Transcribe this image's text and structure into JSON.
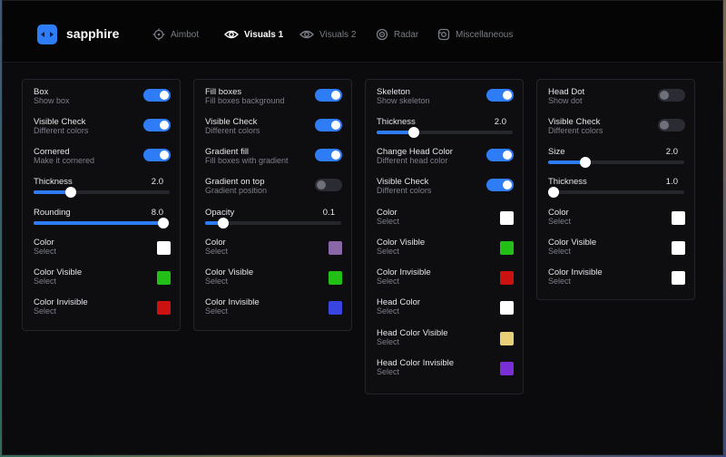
{
  "brand": {
    "name": "sapphire",
    "accent": "#2f7df6"
  },
  "tabs": [
    {
      "label": "Aimbot",
      "icon": "crosshair-icon",
      "active": false
    },
    {
      "label": "Visuals 1",
      "icon": "eye-icon",
      "active": true
    },
    {
      "label": "Visuals 2",
      "icon": "eye-icon",
      "active": false
    },
    {
      "label": "Radar",
      "icon": "radar-icon",
      "active": false
    },
    {
      "label": "Miscellaneous",
      "icon": "misc-icon",
      "active": false
    }
  ],
  "panels": [
    {
      "rows": [
        {
          "type": "toggle",
          "label": "Box",
          "sub": "Show box",
          "on": true
        },
        {
          "type": "toggle",
          "label": "Visible Check",
          "sub": "Different colors",
          "on": true
        },
        {
          "type": "toggle",
          "label": "Cornered",
          "sub": "Make it cornered",
          "on": true
        },
        {
          "type": "slider",
          "label": "Thickness",
          "value": "2.0",
          "fraction": 0.27
        },
        {
          "type": "slider",
          "label": "Rounding",
          "value": "8.0",
          "fraction": 0.95
        },
        {
          "type": "color",
          "label": "Color",
          "sub": "Select",
          "color": "#ffffff"
        },
        {
          "type": "color",
          "label": "Color Visible",
          "sub": "Select",
          "color": "#22c016"
        },
        {
          "type": "color",
          "label": "Color Invisible",
          "sub": "Select",
          "color": "#cc1111"
        }
      ]
    },
    {
      "rows": [
        {
          "type": "toggle",
          "label": "Fill boxes",
          "sub": "Fill boxes background",
          "on": true
        },
        {
          "type": "toggle",
          "label": "Visible Check",
          "sub": "Different colors",
          "on": true
        },
        {
          "type": "toggle",
          "label": "Gradient fill",
          "sub": "Fill boxes with gradient",
          "on": true
        },
        {
          "type": "toggle",
          "label": "Gradient on top",
          "sub": "Gradient position",
          "on": false
        },
        {
          "type": "slider",
          "label": "Opacity",
          "value": "0.1",
          "fraction": 0.13
        },
        {
          "type": "color",
          "label": "Color",
          "sub": "Select",
          "color": "#8a68a8"
        },
        {
          "type": "color",
          "label": "Color Visible",
          "sub": "Select",
          "color": "#22c016"
        },
        {
          "type": "color",
          "label": "Color Invisible",
          "sub": "Select",
          "color": "#3a44e0"
        }
      ]
    },
    {
      "rows": [
        {
          "type": "toggle",
          "label": "Skeleton",
          "sub": "Show skeleton",
          "on": true
        },
        {
          "type": "slider",
          "label": "Thickness",
          "value": "2.0",
          "fraction": 0.27
        },
        {
          "type": "toggle",
          "label": "Change Head Color",
          "sub": "Different head color",
          "on": true
        },
        {
          "type": "toggle",
          "label": "Visible Check",
          "sub": "Different colors",
          "on": true
        },
        {
          "type": "color",
          "label": "Color",
          "sub": "Select",
          "color": "#ffffff"
        },
        {
          "type": "color",
          "label": "Color Visible",
          "sub": "Select",
          "color": "#22c016"
        },
        {
          "type": "color",
          "label": "Color Invisible",
          "sub": "Select",
          "color": "#cc1111"
        },
        {
          "type": "color",
          "label": "Head Color",
          "sub": "Select",
          "color": "#ffffff"
        },
        {
          "type": "color",
          "label": "Head Color Visible",
          "sub": "Select",
          "color": "#e8cf78"
        },
        {
          "type": "color",
          "label": "Head Color Invisible",
          "sub": "Select",
          "color": "#7a2ed6"
        }
      ]
    },
    {
      "rows": [
        {
          "type": "toggle",
          "label": "Head Dot",
          "sub": "Show dot",
          "on": false
        },
        {
          "type": "toggle",
          "label": "Visible Check",
          "sub": "Different colors",
          "on": false
        },
        {
          "type": "slider",
          "label": "Size",
          "value": "2.0",
          "fraction": 0.27
        },
        {
          "type": "slider",
          "label": "Thickness",
          "value": "1.0",
          "fraction": 0.04
        },
        {
          "type": "color",
          "label": "Color",
          "sub": "Select",
          "color": "#ffffff"
        },
        {
          "type": "color",
          "label": "Color Visible",
          "sub": "Select",
          "color": "#ffffff"
        },
        {
          "type": "color",
          "label": "Color Invisible",
          "sub": "Select",
          "color": "#ffffff"
        }
      ]
    }
  ]
}
